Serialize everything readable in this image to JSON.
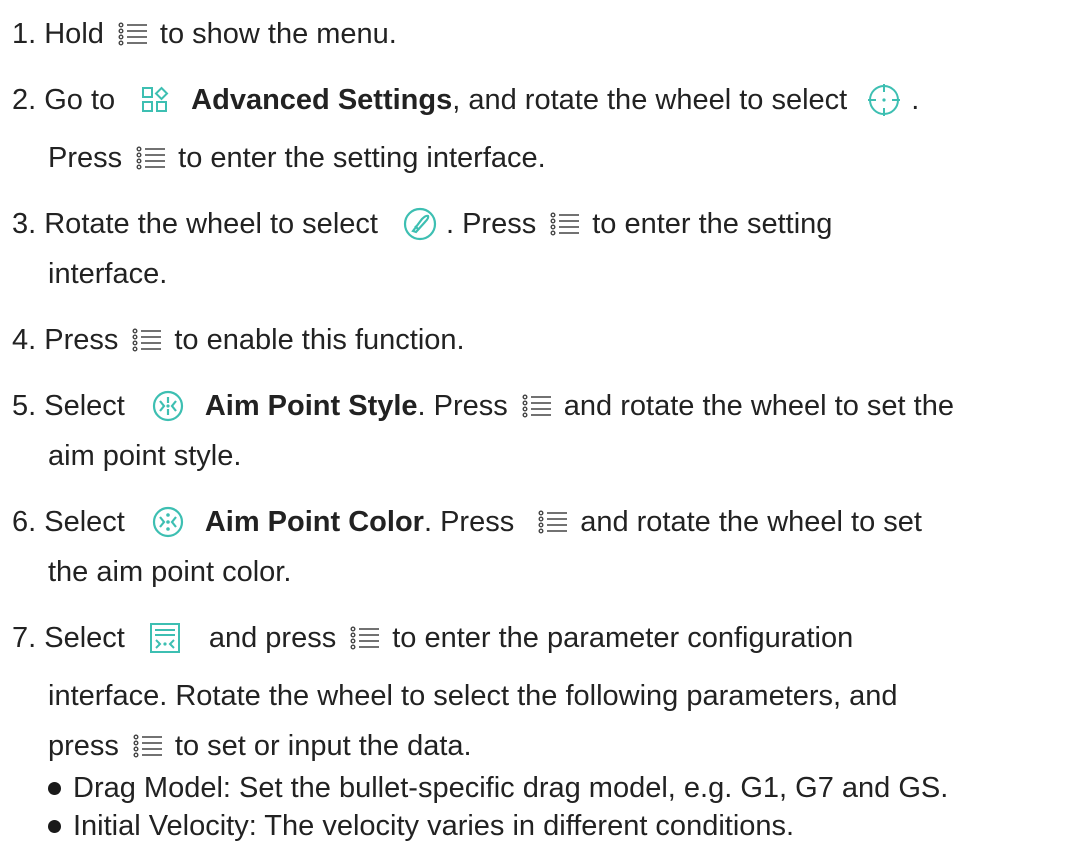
{
  "colors": {
    "text": "#222222",
    "accent": "#3dbfb2"
  },
  "icons": {
    "menu": "menu-list-icon",
    "advanced": "advanced-settings-icon",
    "zeroing": "crosshair-icon",
    "ballistic": "ballistic-bullet-icon",
    "aim_style": "aim-point-style-icon",
    "aim_color": "aim-point-color-icon",
    "params": "parameter-config-icon"
  },
  "step1": {
    "prefix": "1. Hold",
    "suffix": "to show the menu."
  },
  "step2": {
    "prefix": "2. Go to",
    "bold": "Advanced Settings",
    "middle": ", and rotate the wheel to select",
    "end": ".",
    "line2_prefix": "Press",
    "line2_suffix": "to enter the setting interface."
  },
  "step3": {
    "prefix": "3. Rotate the wheel to select",
    "middle": ". Press",
    "suffix": "to enter the setting",
    "line2": "interface."
  },
  "step4": {
    "prefix": "4. Press",
    "suffix": "to enable this function."
  },
  "step5": {
    "prefix": "5. Select",
    "bold": "Aim Point Style",
    "middle": ". Press",
    "suffix": "and rotate the wheel to set the",
    "line2": "aim point style."
  },
  "step6": {
    "prefix": "6. Select",
    "bold": "Aim Point Color",
    "middle": ". Press",
    "suffix": "and rotate the wheel to set",
    "line2": "the aim point color."
  },
  "step7": {
    "prefix": "7. Select",
    "middle": "and press",
    "suffix": "to enter the parameter configuration",
    "line2": "interface. Rotate the wheel to select the following parameters, and",
    "line3_prefix": "press",
    "line3_suffix": "to set or input the data."
  },
  "bullets": [
    "Drag Model: Set the bullet-specific drag model, e.g. G1, G7 and GS.",
    "Initial Velocity: The velocity varies in different conditions."
  ]
}
